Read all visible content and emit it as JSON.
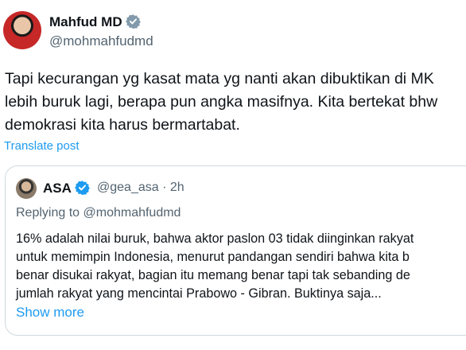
{
  "author": {
    "name": "Mahfud MD",
    "handle": "@mohmahfudmd",
    "badge_color": "#829aab"
  },
  "tweet": {
    "lines": [
      "Tapi kecurangan yg kasat mata yg nanti akan dibuktikan di MK",
      "lebih buruk lagi, berapa pun angka masifnya. Kita bertekat bhw",
      "demokrasi kita harus bermartabat."
    ],
    "translate_label": "Translate post"
  },
  "quoted": {
    "name": "ASA",
    "handle": "@gea_asa",
    "separator": "·",
    "time": "2h",
    "badge_color": "#1d9bf0",
    "replying_to": "Replying to @mohmahfudmd",
    "lines": [
      "16% adalah nilai buruk, bahwa aktor paslon 03 tidak diinginkan rakyat",
      "untuk memimpin Indonesia, menurut pandangan sendiri bahwa kita b",
      "benar disukai rakyat, bagian itu memang benar tapi tak sebanding de",
      "jumlah rakyat yang mencintai Prabowo - Gibran. Buktinya saja..."
    ],
    "show_more_label": "Show more"
  },
  "colors": {
    "text": "#0f1419",
    "secondary": "#536471",
    "link": "#1d9bf0",
    "border": "#cfd9de"
  }
}
